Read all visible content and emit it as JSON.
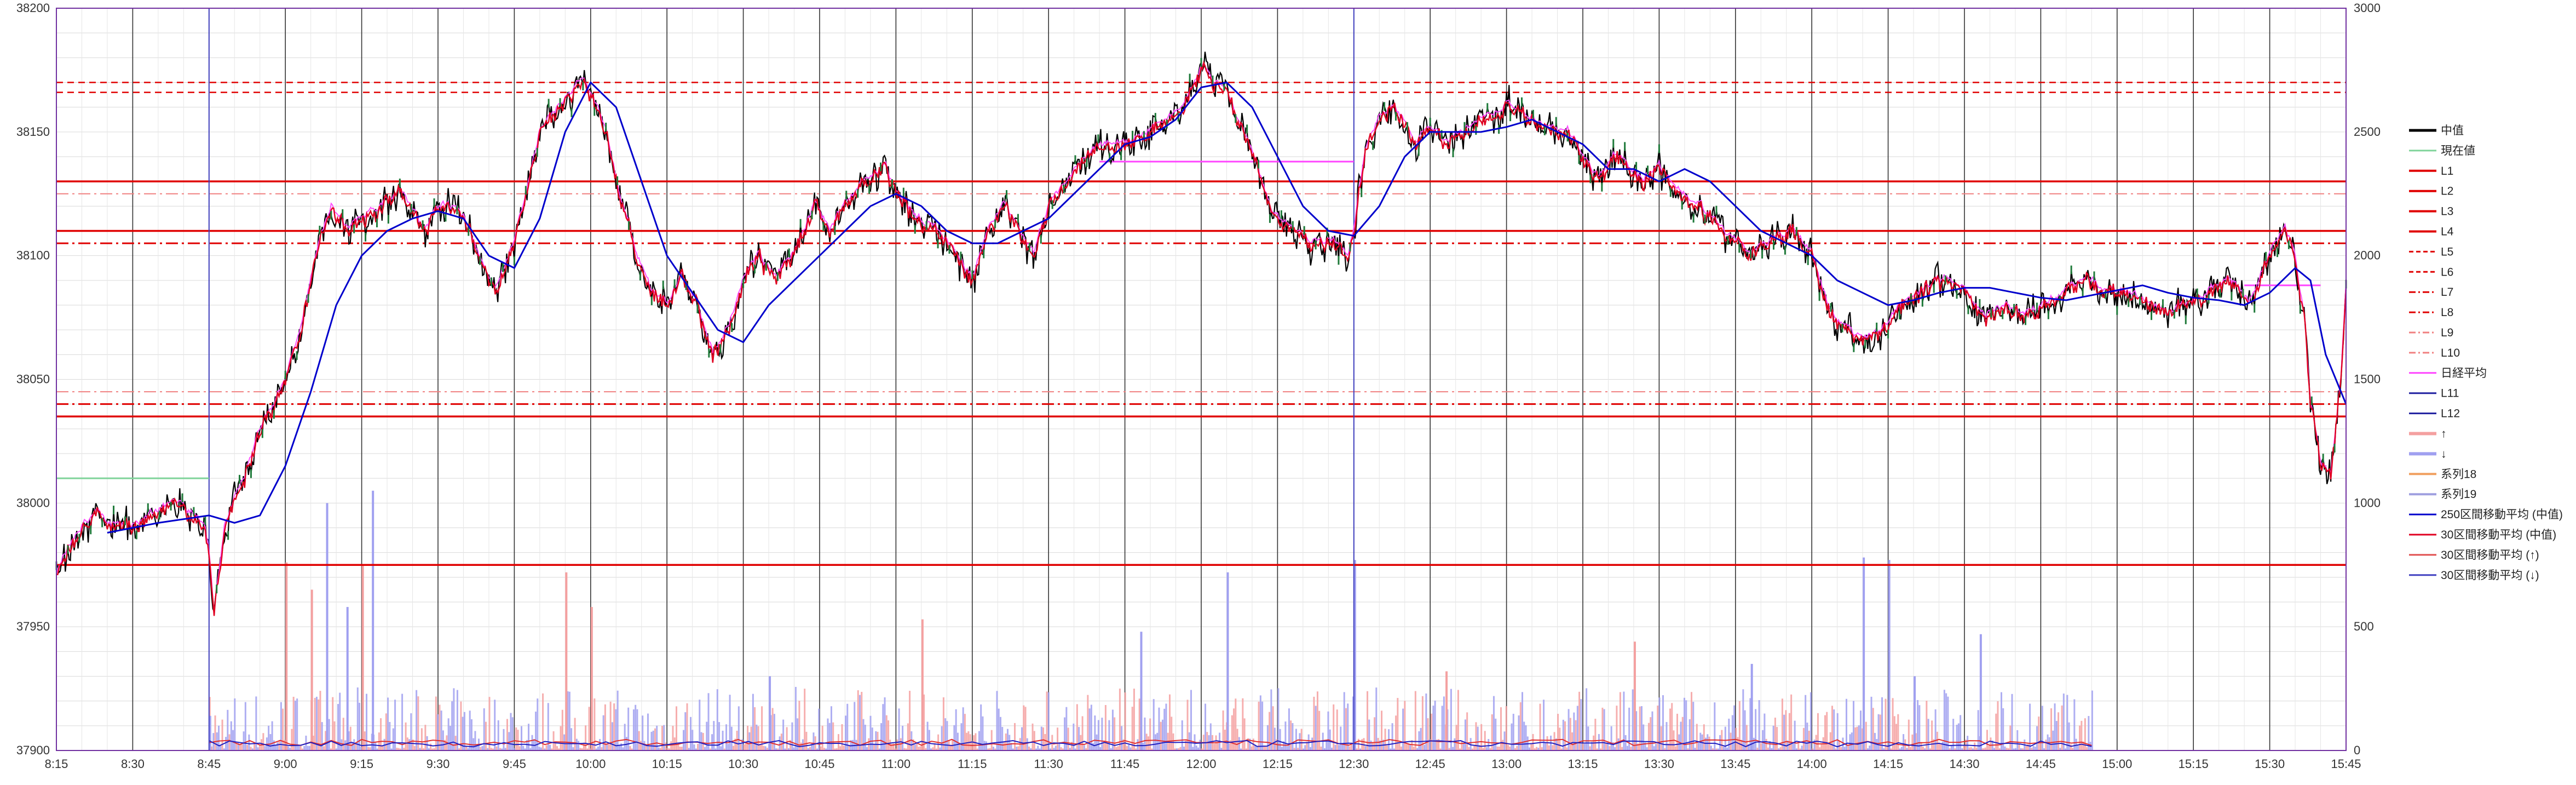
{
  "chart_data": {
    "type": "line",
    "title": "",
    "xlabel": "",
    "ylabel": "",
    "ylim": [
      37900,
      38200
    ],
    "y2lim": [
      0,
      3000
    ],
    "yticks": [
      37900,
      37950,
      38000,
      38050,
      38100,
      38150,
      38200
    ],
    "y2ticks": [
      0,
      500,
      1000,
      1500,
      2000,
      2500,
      3000
    ],
    "xlim": [
      "8:15",
      "15:45"
    ],
    "xticks": [
      "8:15",
      "8:30",
      "8:45",
      "9:00",
      "9:15",
      "9:30",
      "9:45",
      "10:00",
      "10:15",
      "10:30",
      "10:45",
      "11:00",
      "11:15",
      "11:30",
      "11:45",
      "12:00",
      "12:15",
      "12:30",
      "12:45",
      "13:00",
      "13:15",
      "13:30",
      "13:45",
      "14:00",
      "14:15",
      "14:30",
      "14:45",
      "15:00",
      "15:15",
      "15:30",
      "15:45"
    ],
    "grid": true,
    "legend_position": "right",
    "colors": {
      "price": "#000000",
      "current": "#7fd39a",
      "solid_level": "#e00000",
      "dashed_level": "#e00000",
      "light_level": "#f08080",
      "daily_avg": "#ff44ff",
      "ma250": "#0000cc",
      "ma30": "#e00020",
      "up_vol": "#f4a0a0",
      "down_vol": "#a0a0f0",
      "session_line": "#000000",
      "axis": "#7030a0"
    },
    "legend": [
      "中值",
      "現在値",
      "L1",
      "L2",
      "L3",
      "L4",
      "L5",
      "L6",
      "L7",
      "L8",
      "L9",
      "L10",
      "日経平均",
      "L11",
      "L12",
      "↑",
      "↓",
      "系列18",
      "系列19",
      "250区間移動平均 (中值)",
      "30区間移動平均 (中值)",
      "30区間移動平均 (↑)",
      "30区間移動平均 (↓)"
    ],
    "levels": [
      {
        "name": "L1",
        "value": 38130,
        "style": "solid",
        "color": "#e00000"
      },
      {
        "name": "L2",
        "value": 38110,
        "style": "solid",
        "color": "#e00000"
      },
      {
        "name": "L3",
        "value": 38035,
        "style": "solid",
        "color": "#e00000"
      },
      {
        "name": "L4",
        "value": 37975,
        "style": "solid",
        "color": "#e00000"
      },
      {
        "name": "L5",
        "value": 38170,
        "style": "dash",
        "color": "#e00000"
      },
      {
        "name": "L6",
        "value": 38166,
        "style": "dash",
        "color": "#e00000"
      },
      {
        "name": "L7",
        "value": 38105,
        "style": "dashdot",
        "color": "#e00000"
      },
      {
        "name": "L8",
        "value": 38040,
        "style": "dashdot",
        "color": "#e00000"
      },
      {
        "name": "L9",
        "value": 38125,
        "style": "dashdot",
        "color": "#f08080"
      },
      {
        "name": "L10",
        "value": 38045,
        "style": "dashdot",
        "color": "#f08080"
      }
    ],
    "session_lines": [
      "8:45",
      "12:30",
      "15:45"
    ],
    "current_segments": [
      {
        "from": "8:15",
        "to": "8:45",
        "value": 38010
      }
    ],
    "daily_avg_segments": [
      {
        "from": "11:40",
        "to": "12:30",
        "value": 38138
      },
      {
        "from": "15:25",
        "to": "15:40",
        "value": 38088
      }
    ],
    "series": [
      {
        "name": "中值",
        "x": [
          "8:15",
          "8:17",
          "8:20",
          "8:23",
          "8:26",
          "8:30",
          "8:34",
          "8:38",
          "8:42",
          "8:44",
          "8:45",
          "8:46",
          "8:48",
          "8:52",
          "8:55",
          "8:58",
          "9:00",
          "9:03",
          "9:06",
          "9:09",
          "9:12",
          "9:15",
          "9:19",
          "9:23",
          "9:27",
          "9:31",
          "9:35",
          "9:38",
          "9:41",
          "9:44",
          "9:47",
          "9:50",
          "9:54",
          "9:58",
          "10:00",
          "10:03",
          "10:06",
          "10:09",
          "10:12",
          "10:15",
          "10:18",
          "10:21",
          "10:24",
          "10:27",
          "10:30",
          "10:33",
          "10:36",
          "10:40",
          "10:44",
          "10:47",
          "10:50",
          "10:54",
          "10:58",
          "11:00",
          "11:04",
          "11:08",
          "11:12",
          "11:15",
          "11:18",
          "11:21",
          "11:24",
          "11:27",
          "11:30",
          "11:34",
          "11:38",
          "11:42",
          "11:46",
          "11:50",
          "11:54",
          "11:58",
          "12:00",
          "12:02",
          "12:05",
          "12:08",
          "12:11",
          "12:14",
          "12:18",
          "12:22",
          "12:26",
          "12:29",
          "12:30",
          "12:32",
          "12:35",
          "12:38",
          "12:42",
          "12:45",
          "12:48",
          "12:52",
          "12:56",
          "13:00",
          "13:04",
          "13:08",
          "13:12",
          "13:15",
          "13:18",
          "13:21",
          "13:24",
          "13:27",
          "13:30",
          "13:34",
          "13:38",
          "13:42",
          "13:45",
          "13:48",
          "13:52",
          "13:56",
          "14:00",
          "14:03",
          "14:06",
          "14:10",
          "14:14",
          "14:18",
          "14:22",
          "14:26",
          "14:30",
          "14:34",
          "14:38",
          "14:42",
          "14:46",
          "14:50",
          "14:54",
          "14:58",
          "15:02",
          "15:06",
          "15:10",
          "15:14",
          "15:18",
          "15:22",
          "15:26",
          "15:29",
          "15:31",
          "15:33",
          "15:35",
          "15:37",
          "15:38",
          "15:40",
          "15:42",
          "15:44",
          "15:45"
        ],
        "values": [
          37970,
          37980,
          37990,
          37995,
          37990,
          37990,
          37995,
          38000,
          37995,
          37990,
          37980,
          37955,
          37990,
          38010,
          38030,
          38040,
          38050,
          38070,
          38100,
          38120,
          38110,
          38115,
          38120,
          38125,
          38110,
          38120,
          38115,
          38100,
          38085,
          38100,
          38120,
          38150,
          38160,
          38170,
          38165,
          38150,
          38120,
          38100,
          38085,
          38080,
          38090,
          38080,
          38060,
          38070,
          38090,
          38100,
          38090,
          38100,
          38120,
          38110,
          38120,
          38130,
          38135,
          38125,
          38115,
          38110,
          38100,
          38090,
          38110,
          38120,
          38110,
          38100,
          38120,
          38130,
          38140,
          38145,
          38145,
          38150,
          38155,
          38165,
          38175,
          38170,
          38165,
          38150,
          38135,
          38115,
          38110,
          38105,
          38105,
          38100,
          38110,
          38140,
          38155,
          38160,
          38145,
          38150,
          38145,
          38150,
          38155,
          38160,
          38155,
          38150,
          38150,
          38140,
          38130,
          38140,
          38135,
          38130,
          38135,
          38125,
          38120,
          38110,
          38105,
          38100,
          38105,
          38110,
          38100,
          38080,
          38070,
          38065,
          38070,
          38080,
          38085,
          38090,
          38085,
          38075,
          38080,
          38075,
          38080,
          38085,
          38090,
          38085,
          38085,
          38080,
          38075,
          38080,
          38085,
          38090,
          38080,
          38095,
          38105,
          38110,
          38100,
          38070,
          38040,
          38015,
          38010,
          38050,
          38090
        ]
      },
      {
        "name": "250区間移動平均 (中值)",
        "x": [
          "8:25",
          "8:35",
          "8:45",
          "8:50",
          "8:55",
          "9:00",
          "9:05",
          "9:10",
          "9:15",
          "9:20",
          "9:25",
          "9:30",
          "9:35",
          "9:40",
          "9:45",
          "9:50",
          "9:55",
          "10:00",
          "10:05",
          "10:10",
          "10:15",
          "10:20",
          "10:25",
          "10:30",
          "10:35",
          "10:40",
          "10:45",
          "10:50",
          "10:55",
          "11:00",
          "11:05",
          "11:10",
          "11:15",
          "11:20",
          "11:25",
          "11:30",
          "11:35",
          "11:40",
          "11:45",
          "11:50",
          "11:55",
          "12:00",
          "12:05",
          "12:10",
          "12:15",
          "12:20",
          "12:25",
          "12:30",
          "12:35",
          "12:40",
          "12:45",
          "12:50",
          "12:55",
          "13:00",
          "13:05",
          "13:10",
          "13:15",
          "13:20",
          "13:25",
          "13:30",
          "13:35",
          "13:40",
          "13:45",
          "13:50",
          "13:55",
          "14:00",
          "14:05",
          "14:10",
          "14:15",
          "14:20",
          "14:25",
          "14:30",
          "14:35",
          "14:40",
          "14:45",
          "14:50",
          "14:55",
          "15:00",
          "15:05",
          "15:10",
          "15:15",
          "15:20",
          "15:25",
          "15:30",
          "15:35",
          "15:38",
          "15:41",
          "15:45"
        ],
        "values": [
          37988,
          37992,
          37995,
          37992,
          37995,
          38015,
          38045,
          38080,
          38100,
          38110,
          38115,
          38118,
          38115,
          38100,
          38095,
          38115,
          38150,
          38170,
          38160,
          38130,
          38100,
          38085,
          38070,
          38065,
          38080,
          38090,
          38100,
          38110,
          38120,
          38125,
          38120,
          38110,
          38105,
          38105,
          38110,
          38115,
          38125,
          38135,
          38145,
          38148,
          38155,
          38168,
          38170,
          38160,
          38140,
          38120,
          38110,
          38108,
          38120,
          38140,
          38150,
          38150,
          38150,
          38152,
          38155,
          38150,
          38145,
          38135,
          38135,
          38130,
          38135,
          38130,
          38120,
          38110,
          38105,
          38100,
          38090,
          38085,
          38080,
          38082,
          38085,
          38087,
          38087,
          38085,
          38083,
          38082,
          38084,
          38086,
          38088,
          38085,
          38083,
          38082,
          38080,
          38085,
          38095,
          38090,
          38060,
          38040
        ]
      }
    ],
    "volume": {
      "axis": "secondary",
      "start": "8:45",
      "end": "14:55",
      "typical_max": 250,
      "spikes": [
        {
          "time": "8:45",
          "value": 140,
          "dir": "down"
        },
        {
          "time": "9:00",
          "value": 760,
          "dir": "up"
        },
        {
          "time": "9:05",
          "value": 650,
          "dir": "up"
        },
        {
          "time": "9:08",
          "value": 1000,
          "dir": "down"
        },
        {
          "time": "9:12",
          "value": 580,
          "dir": "down"
        },
        {
          "time": "9:15",
          "value": 750,
          "dir": "up"
        },
        {
          "time": "9:17",
          "value": 1050,
          "dir": "down"
        },
        {
          "time": "9:55",
          "value": 720,
          "dir": "up"
        },
        {
          "time": "10:00",
          "value": 580,
          "dir": "up"
        },
        {
          "time": "10:35",
          "value": 300,
          "dir": "down"
        },
        {
          "time": "11:05",
          "value": 530,
          "dir": "up"
        },
        {
          "time": "11:48",
          "value": 480,
          "dir": "down"
        },
        {
          "time": "12:05",
          "value": 720,
          "dir": "down"
        },
        {
          "time": "12:30",
          "value": 770,
          "dir": "down"
        },
        {
          "time": "12:48",
          "value": 320,
          "dir": "up"
        },
        {
          "time": "13:25",
          "value": 440,
          "dir": "up"
        },
        {
          "time": "13:48",
          "value": 350,
          "dir": "down"
        },
        {
          "time": "14:10",
          "value": 780,
          "dir": "down"
        },
        {
          "time": "14:15",
          "value": 770,
          "dir": "down"
        },
        {
          "time": "14:20",
          "value": 300,
          "dir": "down"
        },
        {
          "time": "14:33",
          "value": 470,
          "dir": "down"
        }
      ]
    }
  }
}
